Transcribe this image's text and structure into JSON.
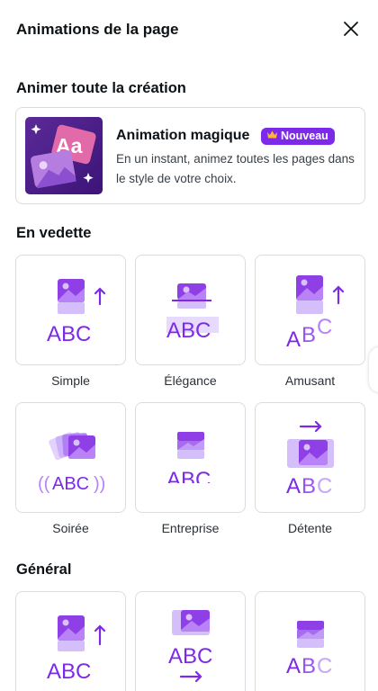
{
  "header": {
    "title": "Animations de la page",
    "close_icon": "close-icon"
  },
  "magic_section": {
    "title": "Animer toute la création",
    "card": {
      "thumb_text": "Aa",
      "title": "Animation magique",
      "badge": "Nouveau",
      "badge_icon": "crown-icon",
      "description": "En un instant, animez toutes les pages dans le style de votre choix."
    }
  },
  "featured": {
    "title": "En vedette",
    "items": [
      {
        "label": "Simple",
        "preview_text": "ABC"
      },
      {
        "label": "Élégance",
        "preview_text": "ABC"
      },
      {
        "label": "Amusant",
        "preview_text": "ABC"
      },
      {
        "label": "Soirée",
        "preview_text": "ABC"
      },
      {
        "label": "Entreprise",
        "preview_text": "ABC"
      },
      {
        "label": "Détente",
        "preview_text": "ABC"
      }
    ]
  },
  "general": {
    "title": "Général",
    "items": [
      {
        "preview_text": "ABC"
      },
      {
        "preview_text": "ABC"
      },
      {
        "preview_text": "ABC"
      }
    ]
  },
  "colors": {
    "accent": "#7d2ae8",
    "accent_light": "#a570ff",
    "accent_pale": "#d7c2fb",
    "border": "#d9dce0"
  }
}
